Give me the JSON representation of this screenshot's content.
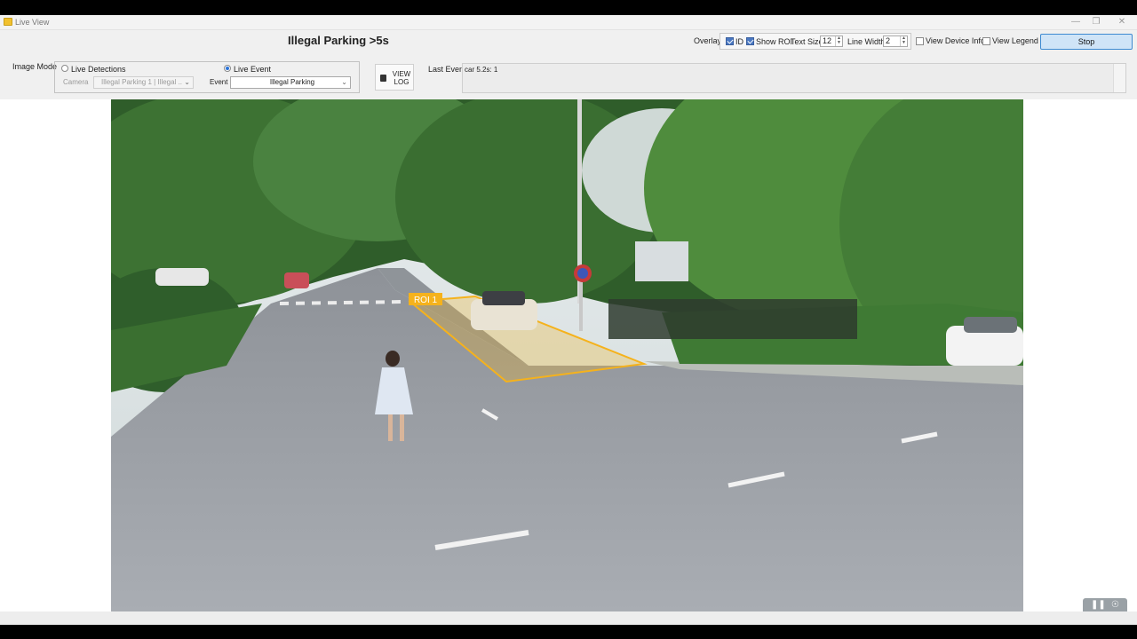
{
  "window": {
    "title": "Live View"
  },
  "header": {
    "title": "Illegal Parking >5s",
    "overlay_label": "Overlay",
    "id_label": "ID",
    "id_checked": true,
    "show_roi_label": "Show ROI",
    "show_roi_checked": true,
    "text_size_label": "Text Size",
    "text_size_value": "12",
    "line_width_label": "Line Width",
    "line_width_value": "2",
    "view_device_info_label": "View Device Info",
    "view_device_info_checked": false,
    "view_legend_label": "View Legend",
    "view_legend_checked": false,
    "stop_label": "Stop"
  },
  "image_mode": {
    "label": "Image Mode",
    "live_detections_label": "Live Detections",
    "live_event_label": "Live Event",
    "selected": "Live Event",
    "camera_label": "Camera",
    "camera_value": "Illegal Parking 1 | Illegal ..",
    "event_label": "Event",
    "event_value": "Illegal Parking"
  },
  "view_log": {
    "line1": "VIEW",
    "line2": "LOG"
  },
  "last_event": {
    "label": "Last Event",
    "value": "car 5.2s: 1"
  },
  "video": {
    "roi_label": "ROI 1",
    "roi_color": "#f5b21c"
  },
  "media_controls": {
    "pause_icon": "pause-icon",
    "settings_icon": "camera-settings-icon"
  }
}
